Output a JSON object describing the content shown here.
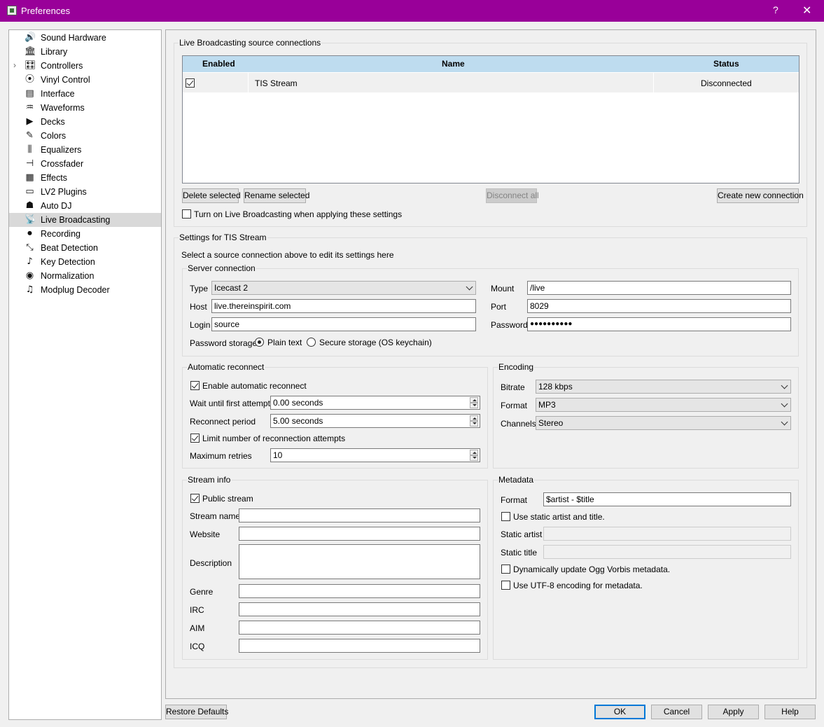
{
  "window": {
    "title": "Preferences",
    "help_label": "?",
    "close_label": "✕"
  },
  "sidebar": {
    "items": [
      {
        "label": "Sound Hardware",
        "icon": "speaker-icon",
        "glyph": "🔊"
      },
      {
        "label": "Library",
        "icon": "library-icon",
        "glyph": "🏛"
      },
      {
        "label": "Controllers",
        "icon": "controller-icon",
        "glyph": "🎛"
      },
      {
        "label": "Vinyl Control",
        "icon": "vinyl-icon",
        "glyph": "⦿"
      },
      {
        "label": "Interface",
        "icon": "interface-icon",
        "glyph": "▤"
      },
      {
        "label": "Waveforms",
        "icon": "waveform-icon",
        "glyph": "♒"
      },
      {
        "label": "Decks",
        "icon": "play-icon",
        "glyph": "▶"
      },
      {
        "label": "Colors",
        "icon": "palette-icon",
        "glyph": "✎"
      },
      {
        "label": "Equalizers",
        "icon": "equalizer-icon",
        "glyph": "⫼"
      },
      {
        "label": "Crossfader",
        "icon": "crossfader-icon",
        "glyph": "⊣"
      },
      {
        "label": "Effects",
        "icon": "effects-icon",
        "glyph": "▦"
      },
      {
        "label": "LV2 Plugins",
        "icon": "lv2-icon",
        "glyph": "▭"
      },
      {
        "label": "Auto DJ",
        "icon": "robot-icon",
        "glyph": "☗"
      },
      {
        "label": "Live Broadcasting",
        "icon": "broadcast-icon",
        "glyph": "📡"
      },
      {
        "label": "Recording",
        "icon": "recording-icon",
        "glyph": "⏺"
      },
      {
        "label": "Beat Detection",
        "icon": "beat-icon",
        "glyph": "⤡"
      },
      {
        "label": "Key Detection",
        "icon": "key-icon",
        "glyph": "♪"
      },
      {
        "label": "Normalization",
        "icon": "normalization-icon",
        "glyph": "◉"
      },
      {
        "label": "Modplug Decoder",
        "icon": "modplug-icon",
        "glyph": "♫"
      }
    ],
    "selected": "Live Broadcasting",
    "expander": "›"
  },
  "connections": {
    "group_title": "Live Broadcasting source connections",
    "columns": {
      "enabled": "Enabled",
      "name": "Name",
      "status": "Status"
    },
    "rows": [
      {
        "enabled": true,
        "name": "TIS Stream",
        "status": "Disconnected"
      }
    ],
    "buttons": {
      "delete": "Delete selected",
      "rename": "Rename selected",
      "disconnect_all": "Disconnect all",
      "create": "Create new connection"
    },
    "turn_on_label": "Turn on Live Broadcasting when applying these settings"
  },
  "settings": {
    "group_title": "Settings for TIS Stream",
    "hint": "Select a source connection above to edit its settings here",
    "server": {
      "title": "Server connection",
      "type_label": "Type",
      "type_value": "Icecast 2",
      "host_label": "Host",
      "host_value": "live.thereinspirit.com",
      "login_label": "Login",
      "login_value": "source",
      "mount_label": "Mount",
      "mount_value": "/live",
      "port_label": "Port",
      "port_value": "8029",
      "password_label": "Password",
      "password_value": "●●●●●●●●●●",
      "storage_label": "Password storage",
      "plain_label": "Plain text",
      "secure_label": "Secure storage (OS keychain)"
    },
    "reconnect": {
      "title": "Automatic reconnect",
      "enable_label": "Enable automatic reconnect",
      "wait_label": "Wait until first attempt",
      "wait_value": "0.00 seconds",
      "period_label": "Reconnect period",
      "period_value": "5.00 seconds",
      "limit_label": "Limit number of reconnection attempts",
      "max_label": "Maximum retries",
      "max_value": "10"
    },
    "encoding": {
      "title": "Encoding",
      "bitrate_label": "Bitrate",
      "bitrate_value": "128 kbps",
      "format_label": "Format",
      "format_value": "MP3",
      "channels_label": "Channels",
      "channels_value": "Stereo"
    },
    "stream_info": {
      "title": "Stream info",
      "public_label": "Public stream",
      "name_label": "Stream name",
      "website_label": "Website",
      "description_label": "Description",
      "genre_label": "Genre",
      "irc_label": "IRC",
      "aim_label": "AIM",
      "icq_label": "ICQ"
    },
    "metadata": {
      "title": "Metadata",
      "format_label": "Format",
      "format_value": "$artist - $title",
      "static_label": "Use static artist and title.",
      "static_artist_label": "Static artist",
      "static_title_label": "Static title",
      "ogg_label": "Dynamically update Ogg Vorbis metadata.",
      "utf8_label": "Use UTF-8 encoding for metadata."
    }
  },
  "footer": {
    "restore": "Restore Defaults",
    "ok": "OK",
    "cancel": "Cancel",
    "apply": "Apply",
    "help": "Help"
  }
}
